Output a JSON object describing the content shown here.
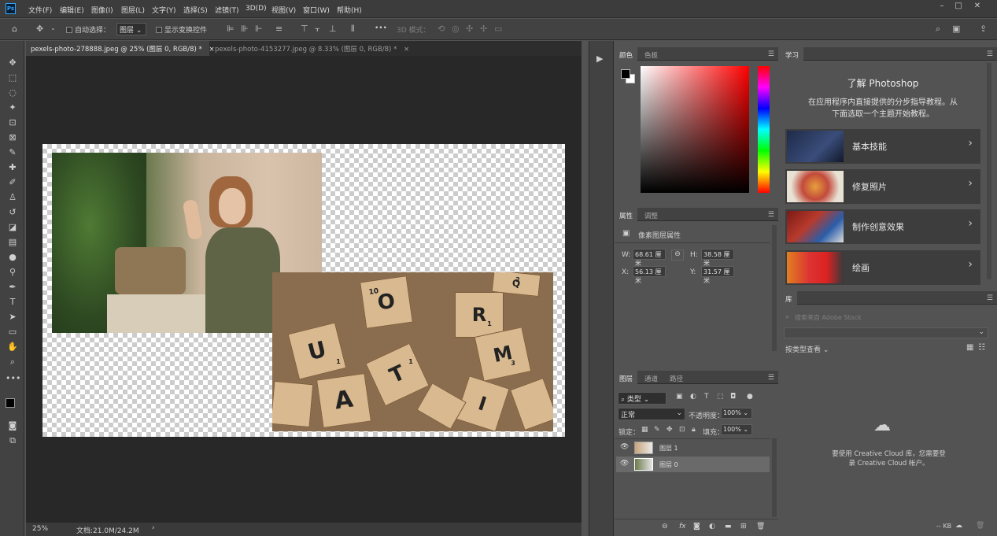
{
  "app": {
    "logo": "Ps"
  },
  "menu": [
    "文件(F)",
    "编辑(E)",
    "图像(I)",
    "图层(L)",
    "文字(Y)",
    "选择(S)",
    "滤镜(T)",
    "3D(D)",
    "视图(V)",
    "窗口(W)",
    "帮助(H)"
  ],
  "options": {
    "auto_select_label": "自动选择：",
    "auto_select_value": "图层",
    "show_transform_label": "显示变换控件",
    "more": "•••",
    "mode_3d_label": "3D 模式："
  },
  "tabs": [
    {
      "label": "pexels-photo-278888.jpeg @ 25% (图层 0, RGB/8) *",
      "close": "×"
    },
    {
      "label": "pexels-photo-4153277.jpeg @ 8.33% (图层 0, RGB/8) *",
      "close": "×"
    }
  ],
  "canvas": {
    "tiles": [
      "O",
      "10",
      "R",
      "1",
      "M",
      "3",
      "U",
      "1",
      "A",
      "T",
      "1",
      "I",
      "Q",
      "2"
    ]
  },
  "status": {
    "zoom": "25%",
    "doc_info": "文档:21.0M/24.2M",
    "arrow": "›"
  },
  "color_panel": {
    "tabs": [
      "颜色",
      "色板"
    ]
  },
  "properties_panel": {
    "tabs": [
      "属性",
      "调整"
    ],
    "type_label": "像素图层属性",
    "w_label": "W:",
    "w_value": "68.61 厘米",
    "h_label": "H:",
    "h_value": "38.58 厘米",
    "x_label": "X:",
    "x_value": "56.13 厘米",
    "y_label": "Y:",
    "y_value": "31.57 厘米"
  },
  "layers_panel": {
    "tabs": [
      "图层",
      "通道",
      "路径"
    ],
    "filter_kind": "类型",
    "blend_mode": "正常",
    "opacity_label": "不透明度：",
    "opacity_value": "100%",
    "lock_label": "锁定：",
    "fill_label": "填充：",
    "fill_value": "100%",
    "layers": [
      {
        "name": "图层 1",
        "visible": true,
        "selected": false
      },
      {
        "name": "图层 0",
        "visible": true,
        "selected": true
      }
    ],
    "footer_icons": [
      "link-icon",
      "fx-icon",
      "mask-icon",
      "adjustment-icon",
      "group-icon",
      "new-layer-icon",
      "trash-icon"
    ]
  },
  "learn_panel": {
    "tab": "学习",
    "title": "了解 Photoshop",
    "desc_line1": "在应用程序内直接提供的分步指导教程。从",
    "desc_line2": "下面选取一个主题开始教程。",
    "items": [
      "基本技能",
      "修复照片",
      "制作创意效果",
      "绘画"
    ]
  },
  "library_panel": {
    "tab": "库",
    "search_placeholder": "搜索来自 Adobe Stock",
    "view_by": "按类型查看",
    "message_line1": "要使用 Creative Cloud 库，您需要登",
    "message_line2": "录 Creative Cloud 帐户。",
    "size": "-- KB"
  },
  "colors": {
    "accent": "#31a8ff",
    "bg": "#535353",
    "canvas_bg": "#282828",
    "fg_swatch": "#000000",
    "bg_swatch": "#ffffff"
  }
}
